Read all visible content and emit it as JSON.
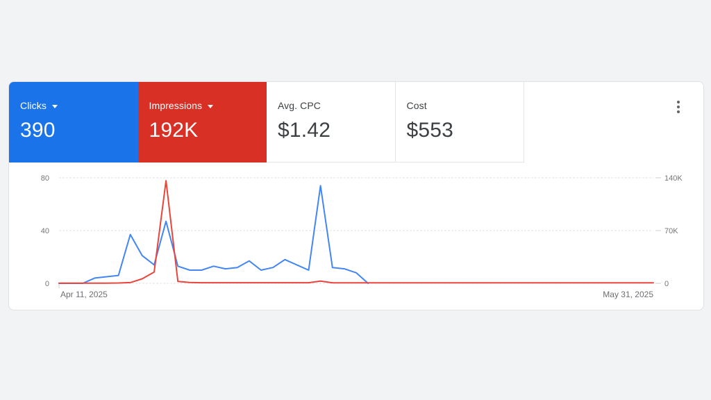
{
  "page": {
    "background_color": "#f1f3f4"
  },
  "scorecards": {
    "clicks": {
      "label": "Clicks",
      "value": "390",
      "color": "#1a73e8",
      "has_dropdown": true
    },
    "impressions": {
      "label": "Impressions",
      "value": "192K",
      "color": "#d93025",
      "has_dropdown": true
    },
    "avg_cpc": {
      "label": "Avg. CPC",
      "value": "$1.42"
    },
    "cost": {
      "label": "Cost",
      "value": "$553"
    }
  },
  "icons": {
    "kebab_menu": "kebab-menu-icon",
    "dropdown_caret": "chevron-down-icon"
  },
  "chart_data": {
    "type": "line",
    "title": "",
    "x_start_label": "Apr 11, 2025",
    "x_end_label": "May 31, 2025",
    "days_total": 51,
    "grid": "horizontal dashed",
    "legend_position": "none",
    "left_axis": {
      "label": "Clicks",
      "ticks": [
        "0",
        "40",
        "80"
      ],
      "range": [
        0,
        80
      ]
    },
    "right_axis": {
      "label": "Impressions",
      "ticks": [
        "0",
        "70K",
        "140K"
      ],
      "range": [
        0,
        140000
      ]
    },
    "series": [
      {
        "name": "Clicks",
        "axis": "left",
        "color": "#4285f4",
        "values": [
          0,
          0,
          0,
          4,
          5,
          6,
          37,
          21,
          14,
          47,
          13,
          10,
          10,
          13,
          11,
          12,
          17,
          10,
          12,
          18,
          14,
          10,
          74,
          12,
          11,
          8,
          0
        ]
      },
      {
        "name": "Impressions",
        "axis": "right",
        "color": "#e8453c",
        "values": [
          200,
          200,
          200,
          300,
          300,
          500,
          1000,
          6000,
          15000,
          136000,
          2500,
          1200,
          800,
          800,
          800,
          800,
          800,
          800,
          800,
          800,
          800,
          800,
          3000,
          700,
          700,
          700,
          700,
          700,
          700,
          700,
          700,
          700,
          700,
          700,
          700,
          700,
          700,
          700,
          700,
          700,
          700,
          700,
          700,
          700,
          700,
          700,
          700,
          700,
          700,
          700,
          700
        ]
      }
    ]
  }
}
